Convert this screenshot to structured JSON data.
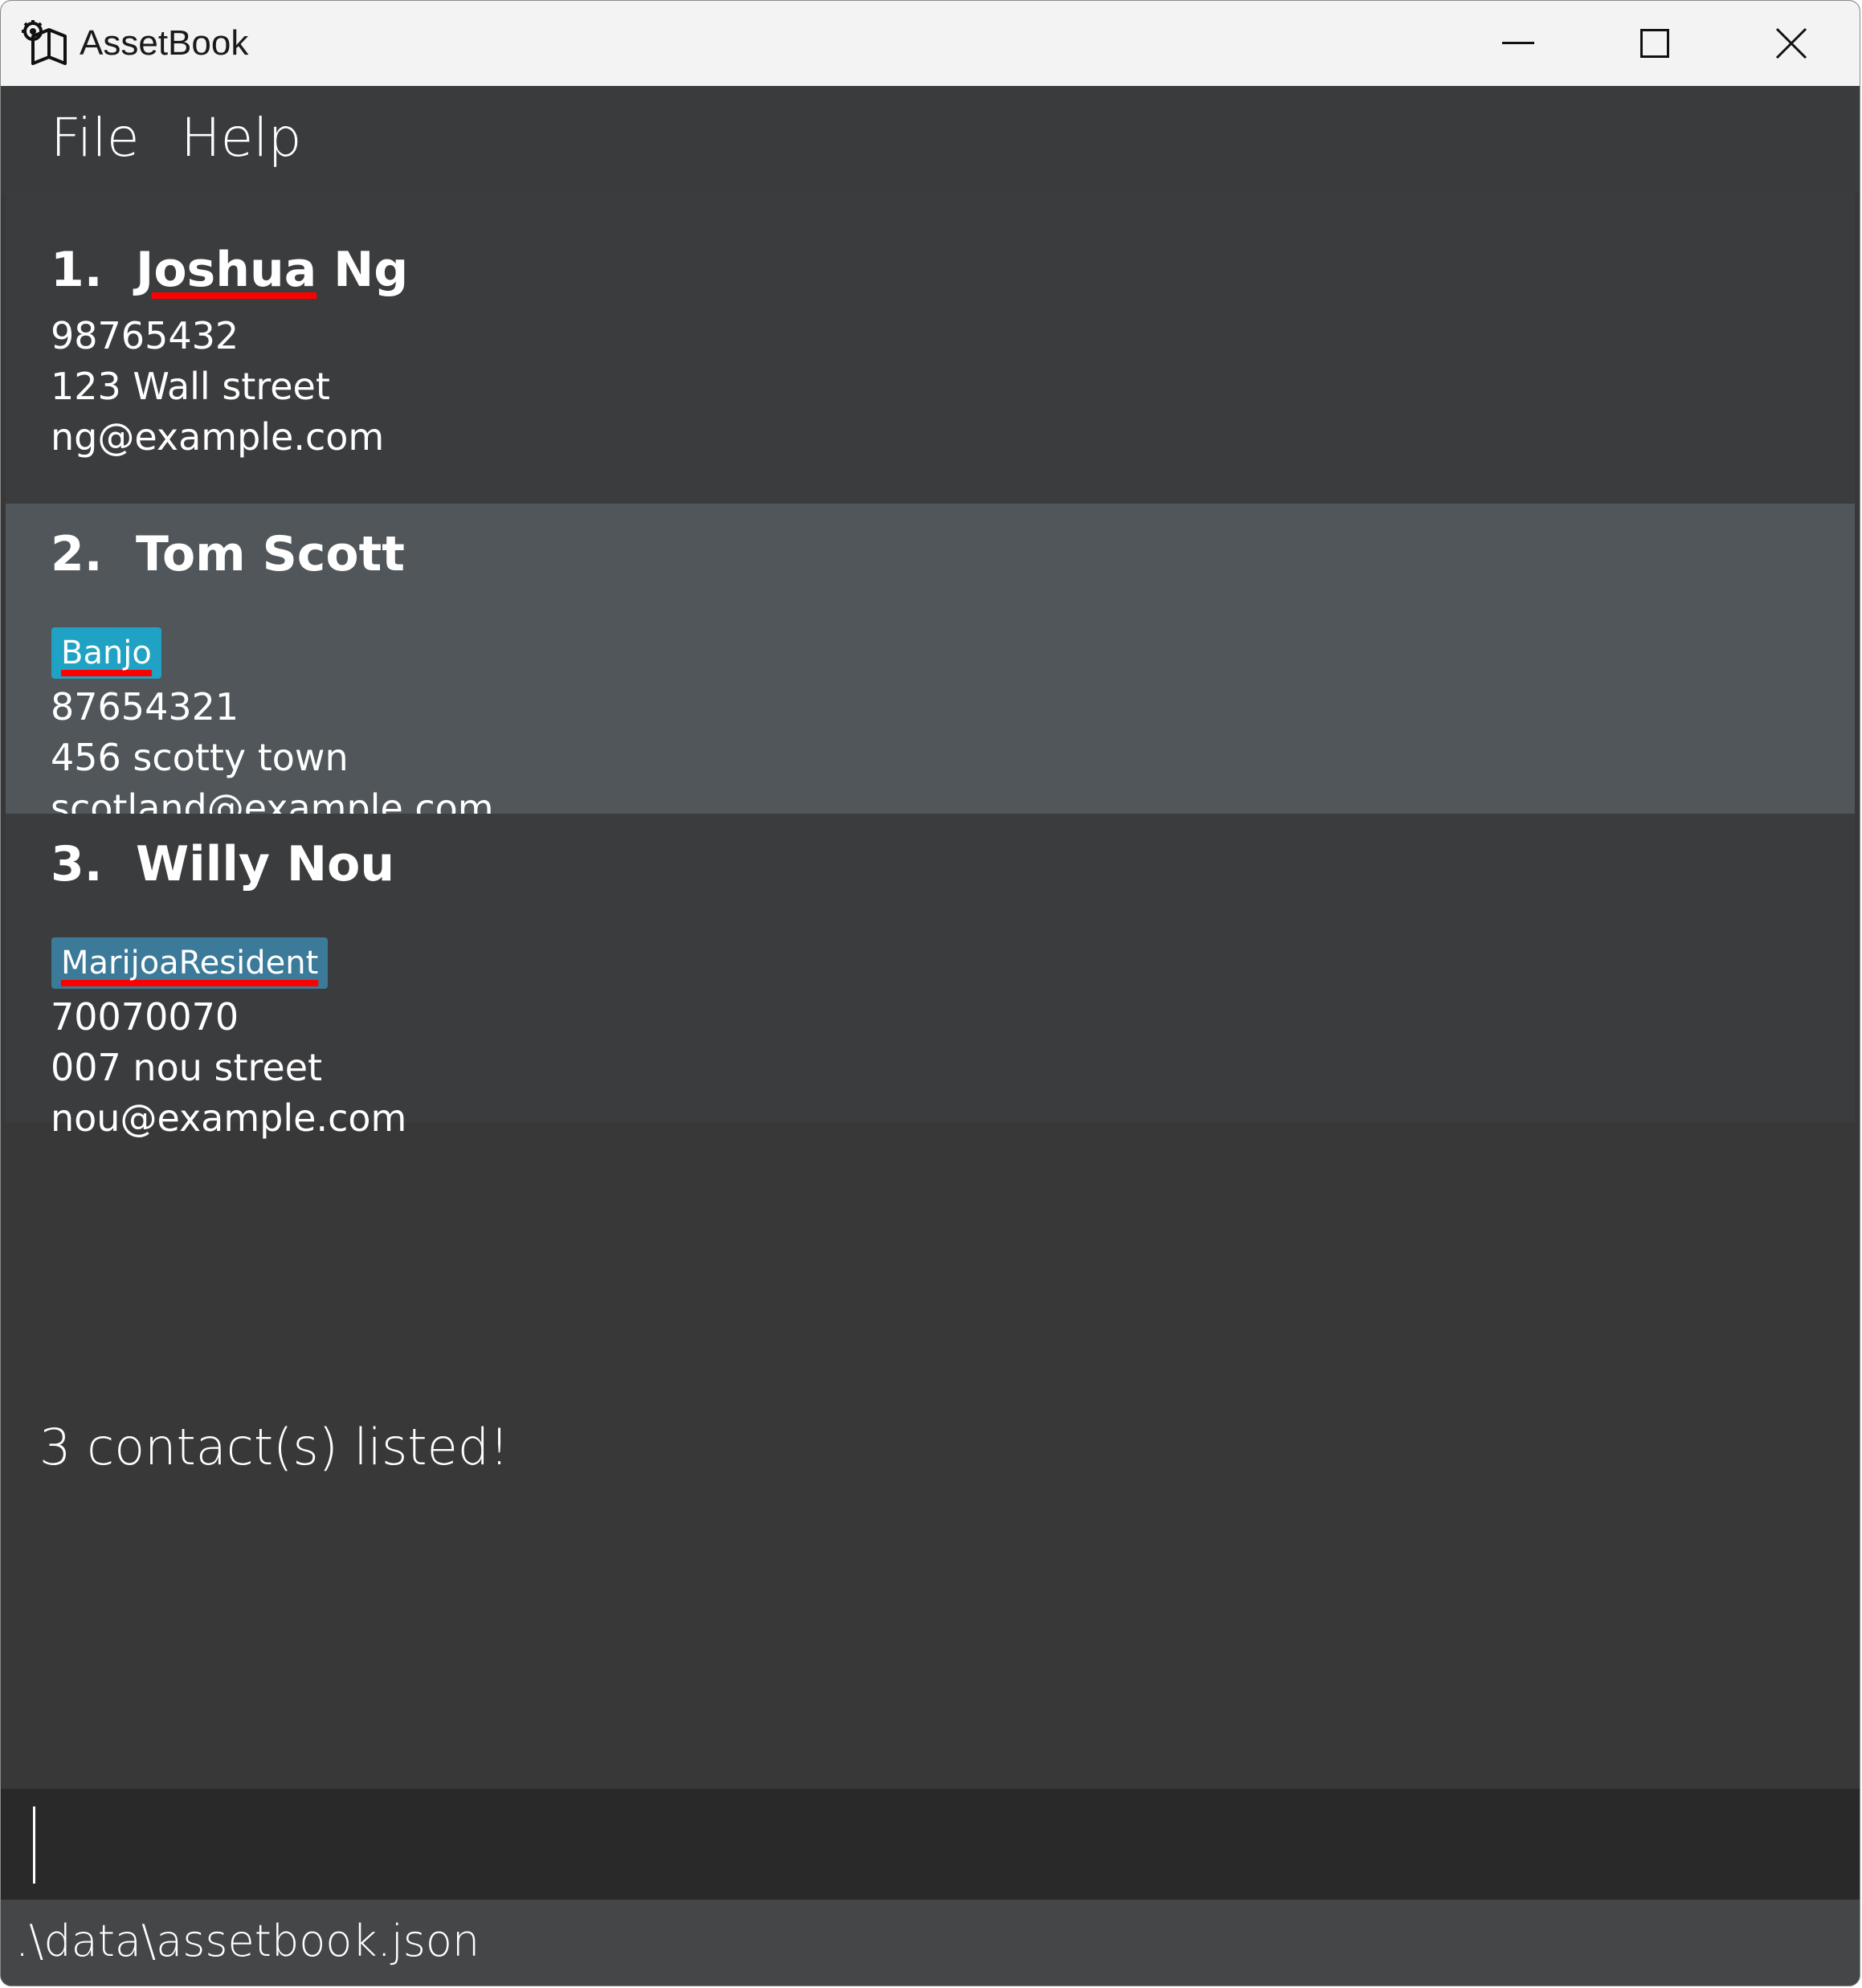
{
  "window": {
    "title": "AssetBook"
  },
  "menu": {
    "file_label": "File",
    "help_label": "Help"
  },
  "persons": [
    {
      "index": "1.",
      "name_first": "Joshua",
      "name_rest": " Ng",
      "tag": "",
      "phone": "98765432",
      "address": "123 Wall street",
      "email": "ng@example.com"
    },
    {
      "index": "2.",
      "name_first": "Tom",
      "name_rest": " Scott",
      "tag": "Banjo",
      "phone": "87654321",
      "address": "456 scotty town",
      "email": "scotland@example.com"
    },
    {
      "index": "3.",
      "name_first": "Willy",
      "name_rest": " Nou",
      "tag": "MarijoaResident",
      "phone": "70070070",
      "address": "007 nou street",
      "email": "nou@example.com"
    }
  ],
  "result": {
    "message": "3 contact(s) listed!"
  },
  "command": {
    "value": ""
  },
  "status": {
    "file_path": ".\\data\\assetbook.json"
  },
  "colors": {
    "tag_banjo": "#1fa2c3",
    "tag_marijoa": "#3b7a99",
    "selected_card": "#505659",
    "background": "#383838"
  },
  "icons": {
    "app": "assetbook-app-icon",
    "minimize": "minimize-icon",
    "maximize": "maximize-icon",
    "close": "close-icon"
  }
}
